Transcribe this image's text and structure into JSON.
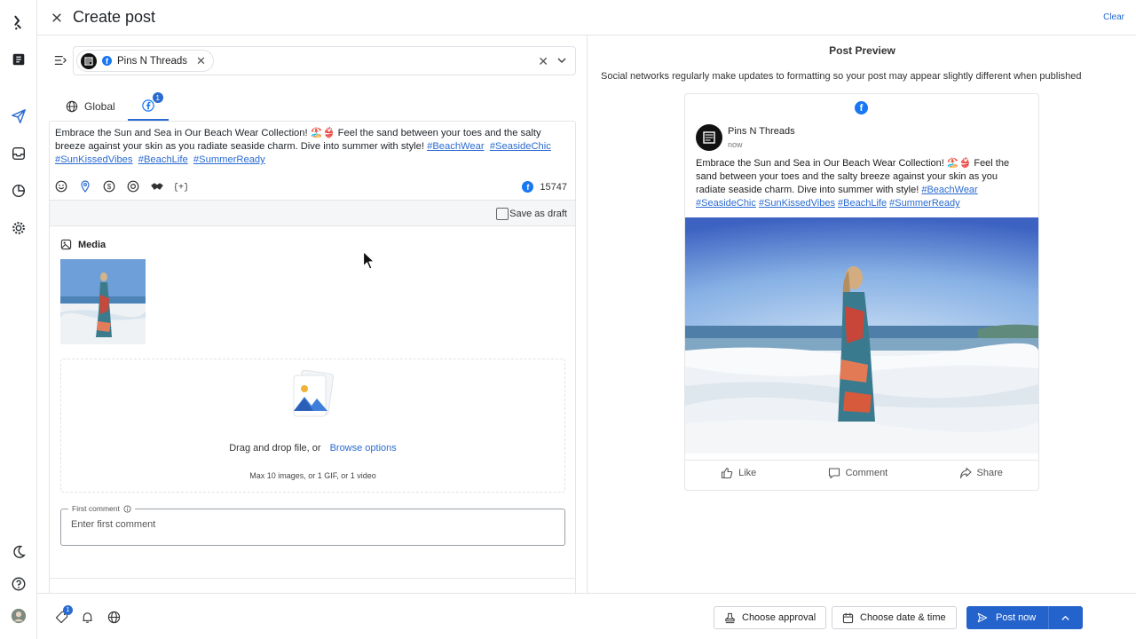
{
  "header": {
    "title": "Create post",
    "clear_label": "Clear"
  },
  "accounts": {
    "selected_chip": "Pins N Threads"
  },
  "tabs": [
    {
      "label": "Global"
    },
    {
      "badge": "1"
    }
  ],
  "composer": {
    "text_plain": "Embrace the Sun and Sea in Our Beach Wear Collection! 🏖️👙 Feel the sand between your toes and the salty breeze against your skin as you radiate seaside charm. Dive into summer with style! ",
    "hashtags": [
      "#BeachWear",
      "#SeasideChic",
      "#SunKissedVibes",
      "#BeachLife",
      "#SummerReady"
    ],
    "char_count": "15747",
    "save_draft_label": "Save as draft"
  },
  "media": {
    "title": "Media",
    "dropzone_text": "Drag and drop file, or",
    "browse_label": "Browse options",
    "limits": "Max 10 images, or 1 GIF, or 1 video"
  },
  "first_comment": {
    "label": "First comment",
    "placeholder": "Enter first comment"
  },
  "preview": {
    "title": "Post Preview",
    "note": "Social networks regularly make updates to formatting so your post may appear slightly different when published",
    "page_name": "Pins N Threads",
    "time": "now",
    "actions": [
      "Like",
      "Comment",
      "Share"
    ]
  },
  "footer": {
    "badge": "1",
    "approval_label": "Choose approval",
    "schedule_label": "Choose date & time",
    "post_label": "Post now"
  },
  "colors": {
    "accent": "#2462cc",
    "link": "#2a6bd1",
    "facebook": "#1877f2"
  }
}
